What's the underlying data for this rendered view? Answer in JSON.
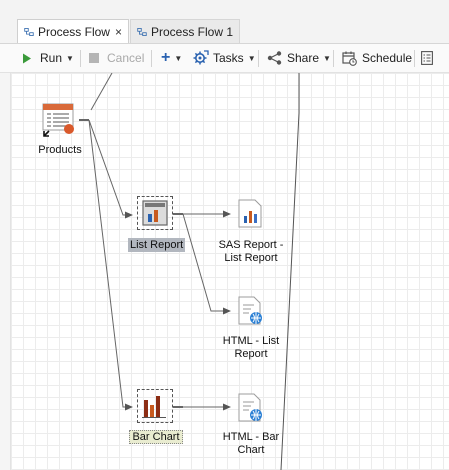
{
  "tabs": [
    {
      "label": "Process Flow",
      "active": true,
      "close": "×"
    },
    {
      "label": "Process Flow 1",
      "active": false
    }
  ],
  "toolbar": {
    "run_label": "Run",
    "cancel_label": "Cancel",
    "add_label": "+",
    "tasks_label": "Tasks",
    "share_label": "Share",
    "schedule_label": "Schedule"
  },
  "nodes": {
    "products": {
      "label": "Products",
      "icon": "table-icon"
    },
    "list_report": {
      "label": "List Report",
      "icon": "list-report-icon"
    },
    "sas_report": {
      "label": "SAS Report -\nList Report",
      "icon": "sas-report-icon"
    },
    "html_list": {
      "label": "HTML - List\nReport",
      "icon": "html-document-icon"
    },
    "bar_chart": {
      "label": "Bar Chart",
      "icon": "bar-chart-icon"
    },
    "html_bar": {
      "label": "HTML - Bar\nChart",
      "icon": "html-document-icon"
    }
  },
  "colors": {
    "accent": "#2a7fd4",
    "run_green": "#3a9a3a",
    "bar_orange": "#c85a1e",
    "bar_blue": "#3a6fc4"
  }
}
